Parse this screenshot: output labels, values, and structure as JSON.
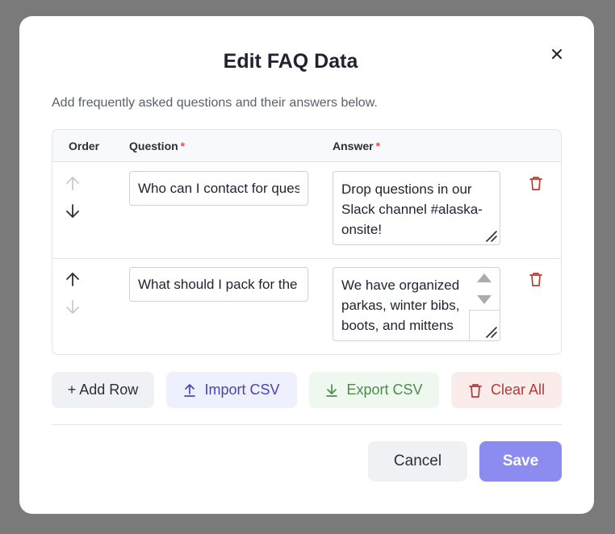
{
  "dialog": {
    "title": "Edit FAQ Data",
    "subtitle": "Add frequently asked questions and their answers below."
  },
  "table": {
    "headers": {
      "order": "Order",
      "question": "Question",
      "answer": "Answer",
      "required_mark": "*"
    },
    "rows": [
      {
        "question": "Who can I contact for questions?",
        "answer": "Drop questions in our Slack channel #alaska-onsite!"
      },
      {
        "question": "What should I pack for the trip?",
        "answer": "We have organized parkas, winter bibs, boots, and mittens"
      }
    ]
  },
  "actions": {
    "add_row": "+ Add Row",
    "import_csv": "Import CSV",
    "export_csv": "Export CSV",
    "clear_all": "Clear All"
  },
  "footer": {
    "cancel": "Cancel",
    "save": "Save"
  },
  "colors": {
    "import_accent": "#4a44b8",
    "export_accent": "#4f8a4f",
    "clear_accent": "#b03a3a",
    "save_bg": "#8c8cf0",
    "required": "#d9534f"
  },
  "icons": {
    "close": "close-icon",
    "move_up": "arrow-up-icon",
    "move_down": "arrow-down-icon",
    "delete": "trash-icon",
    "import": "upload-icon",
    "export": "download-icon",
    "clear": "trash-icon",
    "resize": "resize-grip-icon"
  }
}
